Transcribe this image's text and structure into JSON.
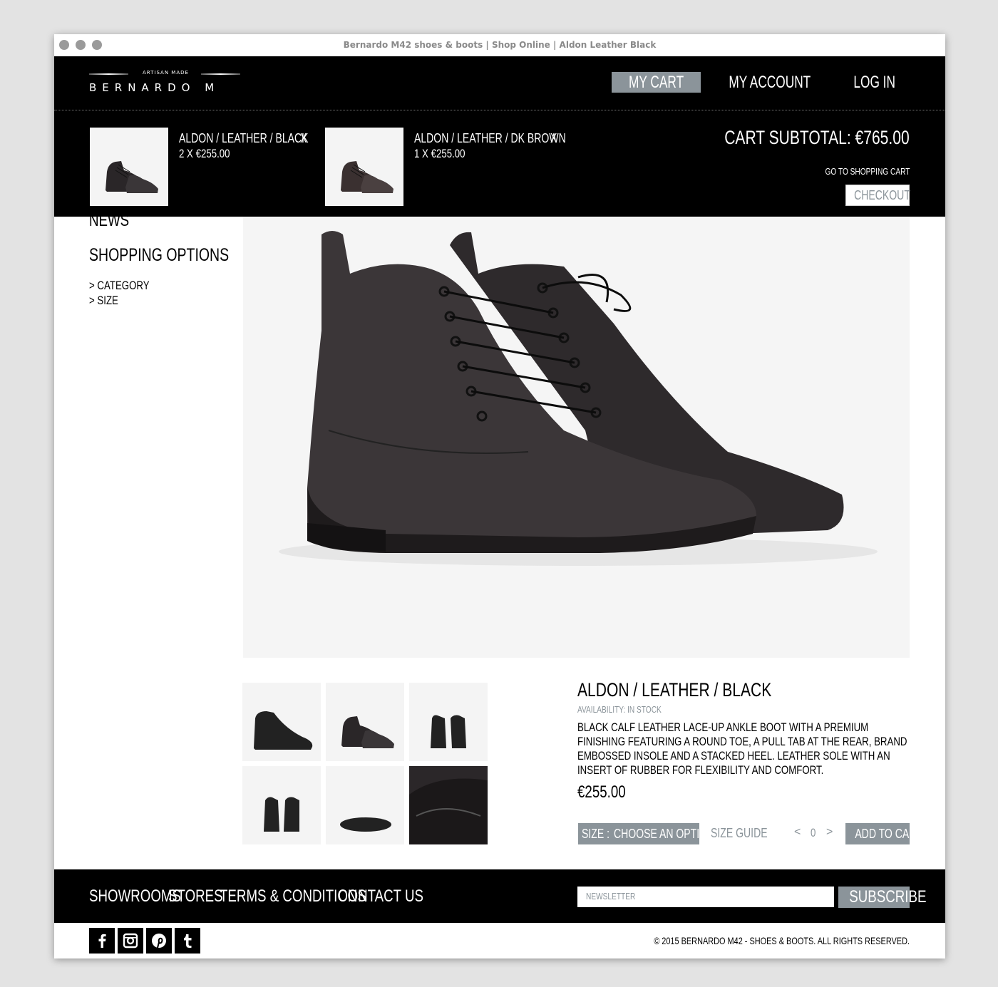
{
  "window": {
    "title": "Bernardo M42 shoes & boots | Shop Online | Aldon Leather Black"
  },
  "logo": {
    "tagline": "ARTISAN   MADE",
    "brand": "BERNARDO M"
  },
  "nav": {
    "my_cart": "MY CART",
    "my_account": "MY ACCOUNT",
    "log_in": "LOG IN"
  },
  "cart": {
    "items": [
      {
        "name": "ALDON / LEATHER / BLACK",
        "qty_price": "2 X €255.00",
        "remove": "X"
      },
      {
        "name": "ALDON / LEATHER / DK BROWN",
        "qty_price": "1 X €255.00",
        "remove": "X"
      }
    ],
    "subtotal": "CART SUBTOTAL: €765.00",
    "go_to_cart": "GO TO SHOPPING CART",
    "checkout": "CHECKOUT"
  },
  "sidebar": {
    "news": "NEWS",
    "heading": "SHOPPING OPTIONS",
    "links": [
      "> CATEGORY",
      "> SIZE"
    ]
  },
  "product": {
    "title": "ALDON / LEATHER / BLACK",
    "availability": "AVAILABILITY: IN STOCK",
    "description": "BLACK CALF LEATHER LACE-UP ANKLE BOOT WITH A PREMIUM FINISHING FEATURING A ROUND TOE, A PULL TAB AT THE REAR, BRAND EMBOSSED INSOLE AND A STACKED HEEL. LEATHER SOLE WITH AN INSERT OF RUBBER FOR FLEXIBILITY AND COMFORT.",
    "price": "€255.00",
    "size_label": "SIZE :",
    "size_value": "CHOOSE AN OPTION",
    "size_guide": "SIZE GUIDE",
    "qty_prev": "<",
    "qty": "0",
    "qty_next": ">",
    "add_to_cart": "ADD TO CART"
  },
  "footer": {
    "links": [
      "SHOWROOMS",
      "STORES",
      "TERMS & CONDITIONS",
      "CONTACT US"
    ],
    "newsletter_placeholder": "NEWSLETTER",
    "subscribe": "SUBSCRIBE",
    "social": [
      {
        "icon": "facebook-icon",
        "glyph": "f"
      },
      {
        "icon": "instagram-icon",
        "glyph": ""
      },
      {
        "icon": "pinterest-icon",
        "glyph": "p"
      },
      {
        "icon": "tumblr-icon",
        "glyph": "t"
      }
    ],
    "copyright": "© 2015 BERNARDO M42 - SHOES & BOOTS. ALL RIGHTS RESERVED."
  },
  "colors": {
    "accent_gray": "#8b949a",
    "header_bg": "#000000"
  }
}
